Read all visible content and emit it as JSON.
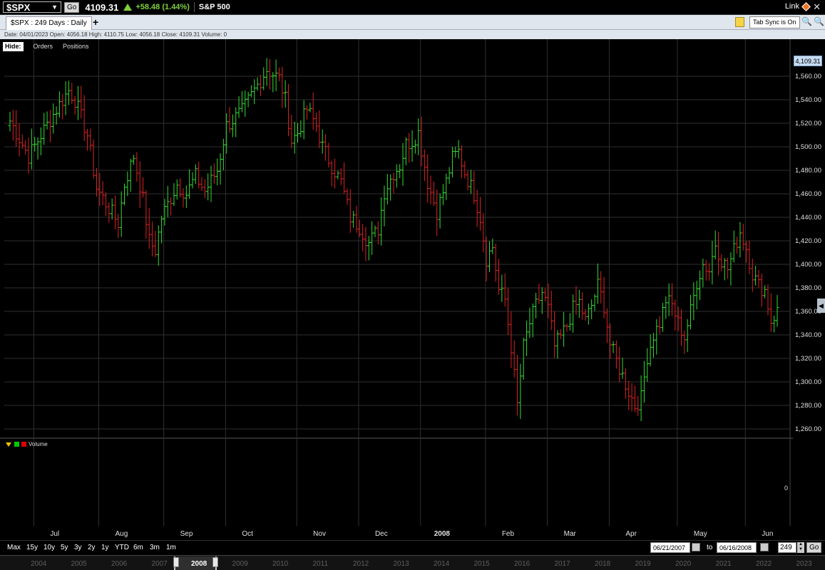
{
  "header": {
    "symbol": "$SPX",
    "go_label": "Go",
    "last_price": "4109.31",
    "change": "+58.48 (1.44%)",
    "name": "S&P 500",
    "link_label": "Link",
    "colors": {
      "up": "#7fd13b",
      "link_diamond": "#f0721e"
    }
  },
  "tabs": {
    "active_label": "$SPX : 249  Days : Daily",
    "add_label": "+",
    "tab_sync_label": "Tab Sync is On"
  },
  "info_line": "Date: 04/01/2023   Open: 4056.18   High: 4110.75   Low: 4056.18   Close: 4109.31   Volume: 0",
  "hide_row": {
    "hide_label": "Hide:",
    "orders_label": "Orders",
    "positions_label": "Positions"
  },
  "price_badge": "4,109.31",
  "volume_pane": {
    "label": "Volume",
    "zero_label": "0",
    "colors": {
      "marker": "#f2c500",
      "up": "#00c800",
      "down": "#e00000"
    }
  },
  "range_bar": {
    "buttons": [
      "Max",
      "15y",
      "10y",
      "5y",
      "3y",
      "2y",
      "1y",
      "YTD",
      "6m",
      "3m",
      "1m"
    ],
    "start_date": "06/21/2007",
    "to_label": "to",
    "end_date": "06/16/2008",
    "days": "249",
    "go_label": "Go"
  },
  "overview": {
    "years": [
      "2004",
      "2005",
      "2006",
      "2007",
      "2008",
      "2009",
      "2010",
      "2011",
      "2012",
      "2013",
      "2014",
      "2015",
      "2016",
      "2017",
      "2018",
      "2019",
      "2020",
      "2021",
      "2022",
      "2023"
    ],
    "selected_year": "2008"
  },
  "chart_data": {
    "type": "ohlc",
    "y_ticks": [
      "1,260.00",
      "1,280.00",
      "1,300.00",
      "1,320.00",
      "1,340.00",
      "1,360.00",
      "1,380.00",
      "1,400.00",
      "1,420.00",
      "1,440.00",
      "1,460.00",
      "1,480.00",
      "1,500.00",
      "1,520.00",
      "1,540.00",
      "1,560.00"
    ],
    "ylim": [
      1253,
      1583
    ],
    "x_labels": [
      "Jul",
      "Aug",
      "Sep",
      "Oct",
      "Nov",
      "Dec",
      "2008",
      "Feb",
      "Mar",
      "Apr",
      "May",
      "Jun"
    ],
    "x_label_bold": "2008",
    "n_bars": 249,
    "colors": {
      "up": "#33dd33",
      "down": "#dd2222",
      "grid": "#2f2f2f"
    },
    "anchors": [
      [
        0,
        1522
      ],
      [
        6,
        1492
      ],
      [
        10,
        1510
      ],
      [
        15,
        1532
      ],
      [
        19,
        1548
      ],
      [
        21,
        1540
      ],
      [
        25,
        1510
      ],
      [
        28,
        1465
      ],
      [
        31,
        1452
      ],
      [
        35,
        1435
      ],
      [
        37,
        1468
      ],
      [
        40,
        1492
      ],
      [
        43,
        1455
      ],
      [
        45,
        1420
      ],
      [
        47,
        1412
      ],
      [
        49,
        1440
      ],
      [
        54,
        1468
      ],
      [
        57,
        1460
      ],
      [
        60,
        1475
      ],
      [
        63,
        1462
      ],
      [
        67,
        1480
      ],
      [
        70,
        1518
      ],
      [
        75,
        1530
      ],
      [
        79,
        1548
      ],
      [
        83,
        1566
      ],
      [
        87,
        1558
      ],
      [
        89,
        1540
      ],
      [
        91,
        1505
      ],
      [
        93,
        1512
      ],
      [
        96,
        1532
      ],
      [
        99,
        1518
      ],
      [
        101,
        1500
      ],
      [
        104,
        1484
      ],
      [
        107,
        1470
      ],
      [
        110,
        1440
      ],
      [
        113,
        1432
      ],
      [
        116,
        1418
      ],
      [
        119,
        1430
      ],
      [
        121,
        1462
      ],
      [
        124,
        1478
      ],
      [
        126,
        1484
      ],
      [
        128,
        1502
      ],
      [
        130,
        1505
      ],
      [
        132,
        1512
      ],
      [
        135,
        1470
      ],
      [
        138,
        1445
      ],
      [
        141,
        1470
      ],
      [
        143,
        1490
      ],
      [
        145,
        1496
      ],
      [
        147,
        1478
      ],
      [
        150,
        1460
      ],
      [
        152,
        1440
      ],
      [
        154,
        1405
      ],
      [
        156,
        1415
      ],
      [
        158,
        1378
      ],
      [
        160,
        1370
      ],
      [
        162,
        1330
      ],
      [
        164,
        1280
      ],
      [
        166,
        1330
      ],
      [
        168,
        1350
      ],
      [
        170,
        1365
      ],
      [
        172,
        1376
      ],
      [
        174,
        1362
      ],
      [
        176,
        1330
      ],
      [
        178,
        1338
      ],
      [
        180,
        1348
      ],
      [
        182,
        1362
      ],
      [
        184,
        1368
      ],
      [
        186,
        1352
      ],
      [
        188,
        1365
      ],
      [
        190,
        1382
      ],
      [
        192,
        1365
      ],
      [
        194,
        1332
      ],
      [
        196,
        1318
      ],
      [
        198,
        1305
      ],
      [
        200,
        1292
      ],
      [
        202,
        1280
      ],
      [
        204,
        1286
      ],
      [
        206,
        1322
      ],
      [
        208,
        1340
      ],
      [
        210,
        1350
      ],
      [
        212,
        1370
      ],
      [
        214,
        1365
      ],
      [
        216,
        1350
      ],
      [
        218,
        1338
      ],
      [
        220,
        1360
      ],
      [
        222,
        1385
      ],
      [
        224,
        1400
      ],
      [
        226,
        1395
      ],
      [
        228,
        1418
      ],
      [
        230,
        1404
      ],
      [
        232,
        1396
      ],
      [
        234,
        1412
      ],
      [
        236,
        1428
      ],
      [
        238,
        1414
      ],
      [
        240,
        1392
      ],
      [
        242,
        1382
      ],
      [
        244,
        1378
      ],
      [
        246,
        1352
      ],
      [
        248,
        1360
      ]
    ]
  }
}
